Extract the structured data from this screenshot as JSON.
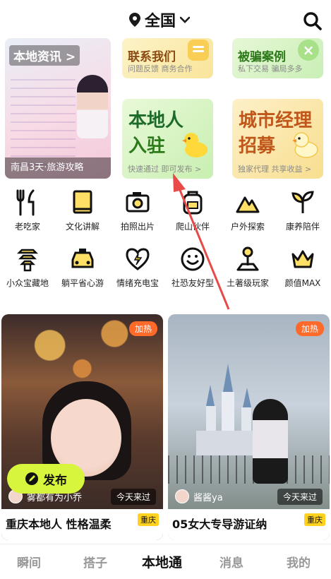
{
  "header": {
    "location": "全国",
    "icons": [
      "location-pin-icon",
      "chevron-down-icon",
      "search-icon"
    ]
  },
  "promo": {
    "tag": "本地资讯 >",
    "caption": "南昌3天·旅游攻略"
  },
  "cards": {
    "contact": {
      "title": "联系我们",
      "subtitle": "问题反馈 商务合作"
    },
    "fraud": {
      "title": "被骗案例",
      "subtitle": "私下交易 骗局多多"
    },
    "local": {
      "line1": "本地人",
      "line2": "入驻",
      "subtitle": "快速通过 即可发布 >"
    },
    "manager": {
      "line1": "城市经理",
      "line2": "招募",
      "subtitle": "独家代理 共享收益 >"
    }
  },
  "categories": [
    {
      "label": "老吃家",
      "icon": "fork-knife-icon"
    },
    {
      "label": "文化讲解",
      "icon": "book-icon"
    },
    {
      "label": "拍照出片",
      "icon": "camera-icon"
    },
    {
      "label": "爬山伙伴",
      "icon": "backpack-icon"
    },
    {
      "label": "户外探索",
      "icon": "mountain-icon"
    },
    {
      "label": "康养陪伴",
      "icon": "sprout-icon"
    },
    {
      "label": "小众宝藏地",
      "icon": "pagoda-icon"
    },
    {
      "label": "躺平省心游",
      "icon": "taxi-icon"
    },
    {
      "label": "情绪充电宝",
      "icon": "heart-bolt-icon"
    },
    {
      "label": "社恐友好型",
      "icon": "smile-icon"
    },
    {
      "label": "土著级玩家",
      "icon": "map-pin-icon"
    },
    {
      "label": "颜值MAX",
      "icon": "crown-icon"
    }
  ],
  "feed": [
    {
      "hot": "加热",
      "user": "雾都有为小乔",
      "time": "今天来过",
      "title": "重庆本地人 性格温柔",
      "badge": "重庆"
    },
    {
      "hot": "加热",
      "user": "酱酱ya",
      "time": "今天来过",
      "title": "05女大专导游证纳",
      "badge": "重庆"
    }
  ],
  "publish": {
    "label": "发布"
  },
  "nav": {
    "tabs": [
      "瞬间",
      "搭子",
      "本地通",
      "消息",
      "我的"
    ],
    "active": "本地通"
  }
}
